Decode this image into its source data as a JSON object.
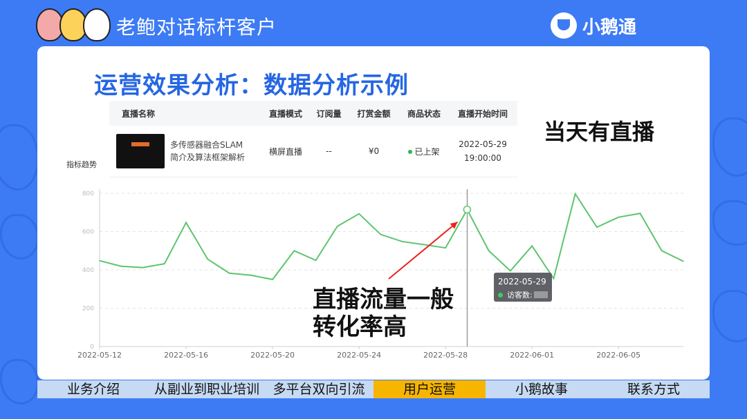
{
  "header": {
    "title": "老鲍对话标杆客户",
    "brand": "小鹅通"
  },
  "slide": {
    "title": "运营效果分析：数据分析示例",
    "side_note": "当天有直播",
    "metric_label": "指标趋势"
  },
  "table": {
    "headers": [
      "直播名称",
      "直播模式",
      "订阅量",
      "打赏金额",
      "商品状态",
      "直播开始时间"
    ],
    "row": {
      "name_line1": "多传感器融合SLAM",
      "name_line2": "简介及算法框架解析",
      "mode": "横屏直播",
      "subs": "--",
      "reward": "¥0",
      "status": "已上架",
      "date": "2022-05-29",
      "time": "19:00:00"
    }
  },
  "annotation": {
    "line1": "直播流量一般",
    "line2": "转化率高"
  },
  "tooltip": {
    "date": "2022-05-29",
    "label": "访客数:"
  },
  "chart_data": {
    "type": "line",
    "x_tick_labels": [
      "2022-05-12",
      "2022-05-16",
      "2022-05-20",
      "2022-05-24",
      "2022-05-28",
      "2022-06-01",
      "2022-06-05"
    ],
    "y_tick_labels": [
      "800",
      "600",
      "400",
      "200",
      "0"
    ],
    "ylim": [
      0,
      800
    ],
    "x": [
      "2022-05-12",
      "2022-05-13",
      "2022-05-14",
      "2022-05-15",
      "2022-05-16",
      "2022-05-17",
      "2022-05-18",
      "2022-05-19",
      "2022-05-20",
      "2022-05-21",
      "2022-05-22",
      "2022-05-23",
      "2022-05-24",
      "2022-05-25",
      "2022-05-26",
      "2022-05-27",
      "2022-05-28",
      "2022-05-29",
      "2022-05-30",
      "2022-05-31",
      "2022-06-01",
      "2022-06-02",
      "2022-06-03",
      "2022-06-04",
      "2022-06-05",
      "2022-06-06",
      "2022-06-07",
      "2022-06-08"
    ],
    "values": [
      448,
      419,
      412,
      432,
      647,
      456,
      383,
      372,
      350,
      500,
      450,
      628,
      693,
      585,
      548,
      532,
      515,
      715,
      500,
      395,
      525,
      355,
      797,
      623,
      675,
      695,
      500,
      445
    ],
    "highlight_x": "2022-05-29",
    "grid": true,
    "line_color": "#5cc46e"
  },
  "nav": {
    "items": [
      "业务介绍",
      "从副业到职业培训",
      "多平台双向引流",
      "用户运营",
      "小鹅故事",
      "联系方式"
    ],
    "active_index": 3
  }
}
